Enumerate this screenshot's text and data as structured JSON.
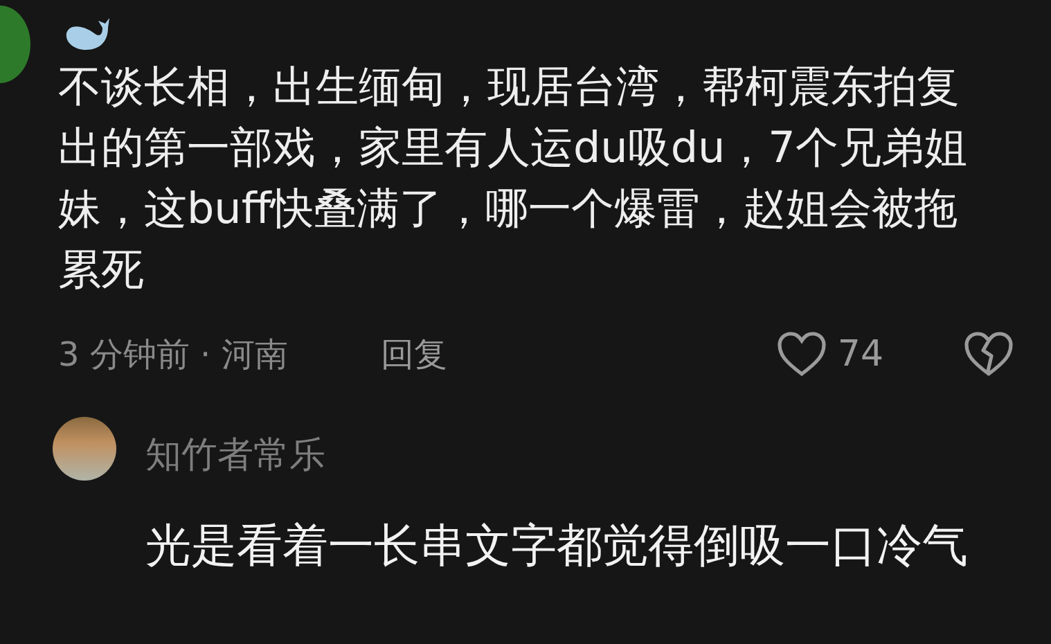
{
  "comment": {
    "text": "不谈长相，出生缅甸，现居台湾，帮柯震东拍复出的第一部戏，家里有人运du吸du，7个兄弟姐妹，这buff快叠满了，哪一个爆雷，赵姐会被拖累死",
    "time_location": "3 分钟前 · 河南",
    "reply_label": "回复",
    "likes": "74"
  },
  "reply": {
    "author": "知竹者常乐",
    "text": "光是看着一长串文字都觉得倒吸一口冷气"
  }
}
